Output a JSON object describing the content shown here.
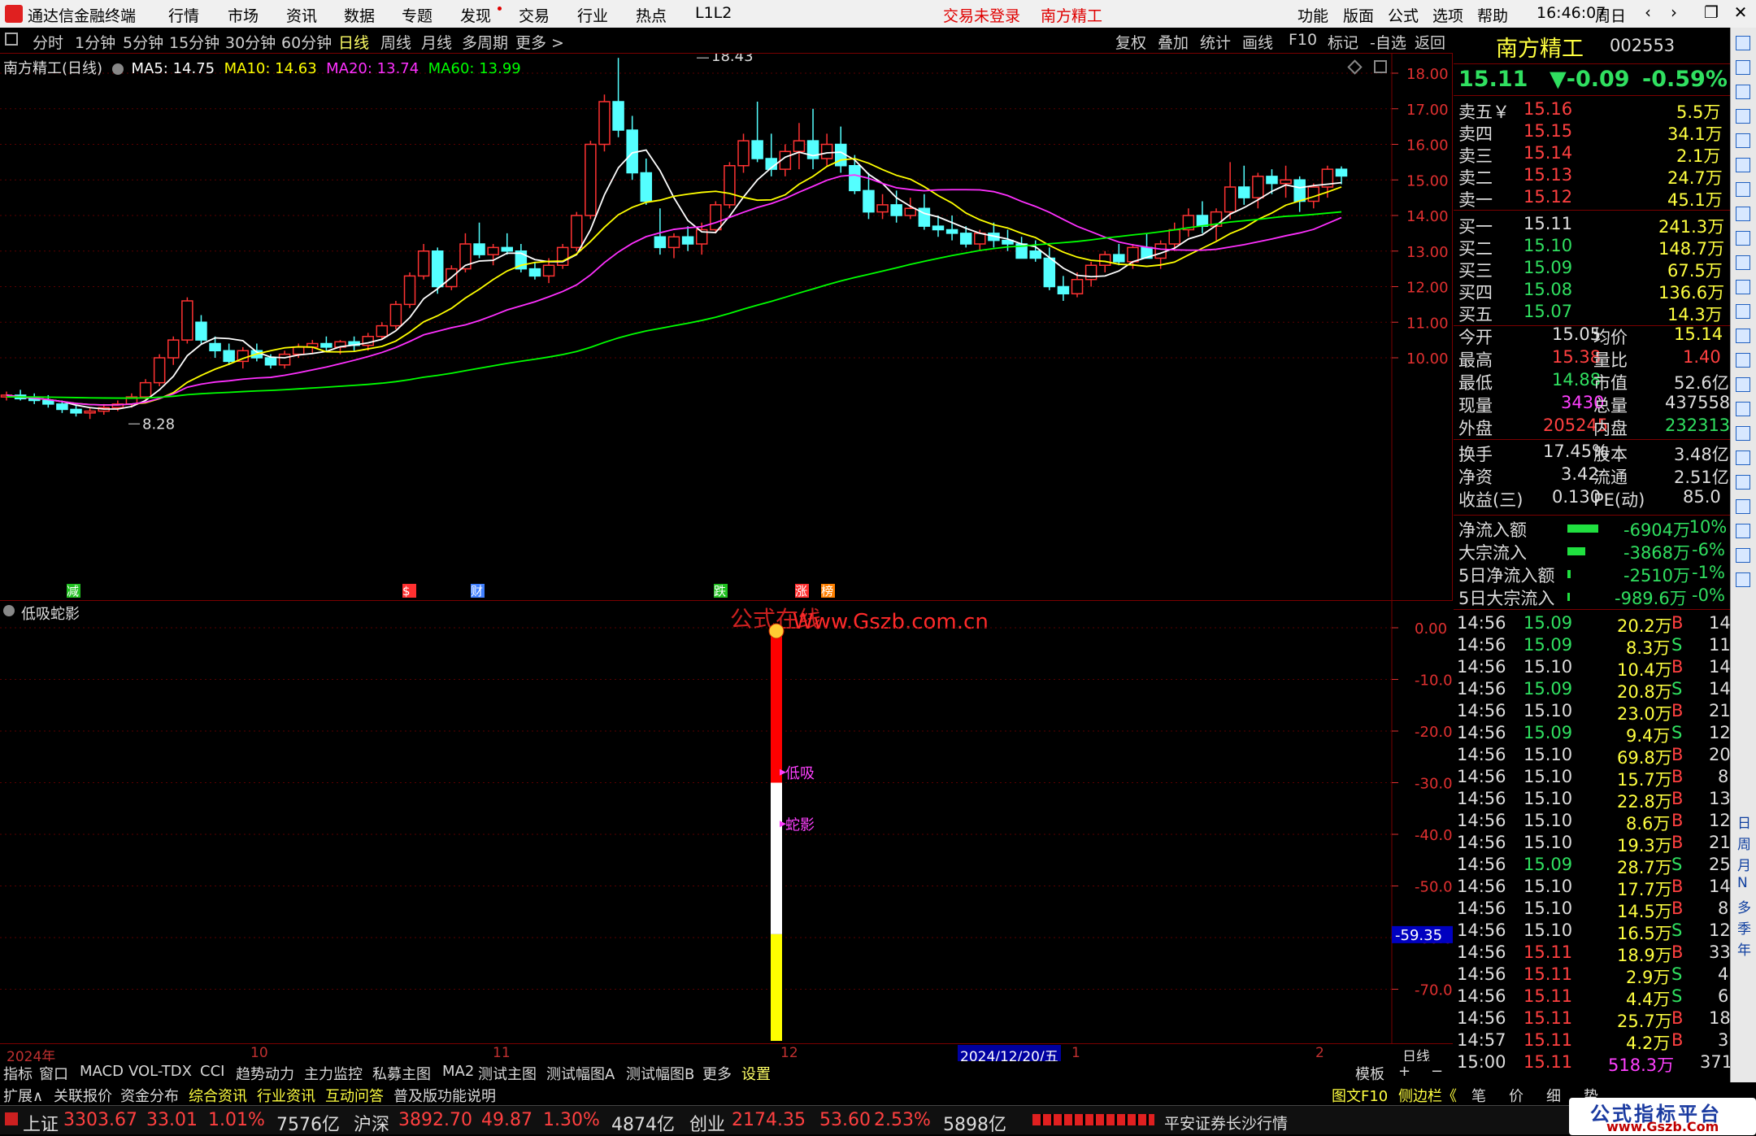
{
  "app": {
    "title": "通达信金融终端",
    "not_logged": "交易未登录",
    "stock_name": "南方精工",
    "clock": "16:46:07",
    "weekday": "周日"
  },
  "menu_left": [
    "行情",
    "市场",
    "资讯",
    "数据",
    "专题",
    "发现",
    "交易",
    "行业",
    "热点",
    "L1L2"
  ],
  "menu_right": [
    "功能",
    "版面",
    "公式",
    "选项",
    "帮助"
  ],
  "window_buttons": [
    "‹",
    "›",
    "❐",
    "–",
    "✕"
  ],
  "toolbar": {
    "periods": [
      "分时",
      "1分钟",
      "5分钟",
      "15分钟",
      "30分钟",
      "60分钟",
      "日线",
      "周线",
      "月线",
      "多周期",
      "更多 >"
    ],
    "active": "日线",
    "right": [
      "复权",
      "叠加",
      "统计",
      "画线",
      "F10",
      "标记",
      "-自选",
      "返回"
    ]
  },
  "legend": {
    "name": "南方精工(日线)",
    "ma5": "MA5: 14.75",
    "ma10": "MA10: 14.63",
    "ma20": "MA20: 13.74",
    "ma60": "MA60: 13.99",
    "c5": "#ffffff",
    "c10": "#ffff00",
    "c20": "#ff30ff",
    "c60": "#00ff00"
  },
  "main_chart": {
    "price_axis": [
      "18.00",
      "17.00",
      "16.00",
      "15.00",
      "14.00",
      "13.00",
      "12.00",
      "11.00",
      "10.00"
    ],
    "high_label": "18.43",
    "low_label": "8.28",
    "events": [
      {
        "t": "减",
        "c": "#20c020"
      },
      {
        "t": "$",
        "c": "#ff3030"
      },
      {
        "t": "财",
        "c": "#4080ff"
      },
      {
        "t": "跌",
        "c": "#20c020"
      },
      {
        "t": "涨",
        "c": "#ff3030"
      },
      {
        "t": "榜",
        "c": "#ff8000"
      }
    ]
  },
  "watermark": {
    "a": "公式在线",
    "b": "Www.Gszb.com.cn"
  },
  "chart_data": [
    {
      "type": "candlestick",
      "title": "南方精工(日线)",
      "ylim": [
        8,
        18.5
      ],
      "ohlc": [
        [
          8.9,
          9.05,
          8.8,
          8.95
        ],
        [
          8.95,
          9.1,
          8.8,
          8.85
        ],
        [
          8.85,
          9.0,
          8.7,
          8.8
        ],
        [
          8.8,
          8.95,
          8.6,
          8.7
        ],
        [
          8.7,
          8.8,
          8.45,
          8.55
        ],
        [
          8.55,
          8.65,
          8.35,
          8.45
        ],
        [
          8.45,
          8.6,
          8.28,
          8.5
        ],
        [
          8.5,
          8.7,
          8.4,
          8.6
        ],
        [
          8.6,
          8.8,
          8.5,
          8.7
        ],
        [
          8.7,
          9.0,
          8.6,
          8.9
        ],
        [
          8.9,
          9.4,
          8.8,
          9.3
        ],
        [
          9.3,
          10.1,
          9.2,
          10.0
        ],
        [
          10.0,
          10.6,
          9.8,
          10.5
        ],
        [
          10.5,
          11.7,
          10.4,
          11.6
        ],
        [
          11.0,
          11.2,
          10.4,
          10.5
        ],
        [
          10.4,
          10.6,
          10.0,
          10.2
        ],
        [
          10.2,
          10.4,
          9.8,
          9.9
        ],
        [
          9.9,
          10.3,
          9.7,
          10.2
        ],
        [
          10.2,
          10.4,
          9.9,
          10.0
        ],
        [
          10.0,
          10.1,
          9.7,
          9.8
        ],
        [
          9.8,
          10.2,
          9.7,
          10.1
        ],
        [
          10.1,
          10.4,
          10.0,
          10.3
        ],
        [
          10.3,
          10.5,
          10.1,
          10.4
        ],
        [
          10.4,
          10.6,
          10.2,
          10.3
        ],
        [
          10.3,
          10.5,
          10.1,
          10.45
        ],
        [
          10.45,
          10.6,
          10.2,
          10.35
        ],
        [
          10.35,
          10.7,
          10.2,
          10.6
        ],
        [
          10.6,
          11.0,
          10.5,
          10.9
        ],
        [
          10.9,
          11.6,
          10.8,
          11.5
        ],
        [
          11.5,
          12.4,
          11.4,
          12.3
        ],
        [
          12.3,
          13.2,
          12.2,
          13.0
        ],
        [
          13.0,
          13.1,
          11.8,
          12.0
        ],
        [
          12.0,
          12.6,
          11.9,
          12.5
        ],
        [
          12.5,
          13.5,
          12.4,
          13.2
        ],
        [
          13.2,
          13.8,
          12.8,
          12.9
        ],
        [
          12.9,
          13.2,
          12.6,
          13.1
        ],
        [
          13.1,
          13.5,
          12.9,
          13.0
        ],
        [
          13.0,
          13.2,
          12.4,
          12.5
        ],
        [
          12.5,
          12.7,
          12.2,
          12.3
        ],
        [
          12.3,
          12.8,
          12.1,
          12.6
        ],
        [
          12.6,
          13.2,
          12.5,
          13.1
        ],
        [
          13.1,
          14.1,
          13.0,
          14.0
        ],
        [
          14.0,
          16.1,
          13.9,
          16.0
        ],
        [
          16.0,
          17.4,
          15.8,
          17.2
        ],
        [
          17.2,
          18.43,
          16.2,
          16.4
        ],
        [
          16.4,
          16.8,
          15.0,
          15.2
        ],
        [
          15.2,
          15.6,
          14.3,
          14.4
        ],
        [
          13.4,
          14.2,
          12.9,
          13.1
        ],
        [
          13.1,
          13.5,
          12.8,
          13.4
        ],
        [
          13.4,
          13.7,
          13.0,
          13.2
        ],
        [
          13.2,
          13.8,
          12.9,
          13.6
        ],
        [
          13.6,
          14.4,
          13.5,
          14.3
        ],
        [
          14.3,
          15.5,
          14.2,
          15.4
        ],
        [
          15.4,
          16.3,
          15.2,
          16.1
        ],
        [
          16.1,
          17.2,
          15.5,
          15.6
        ],
        [
          15.6,
          16.3,
          15.1,
          15.3
        ],
        [
          15.3,
          16.0,
          15.1,
          15.8
        ],
        [
          15.8,
          16.6,
          15.3,
          16.1
        ],
        [
          16.1,
          17.0,
          15.3,
          15.6
        ],
        [
          15.6,
          16.3,
          15.4,
          16.0
        ],
        [
          16.0,
          16.5,
          15.2,
          15.4
        ],
        [
          15.4,
          15.7,
          14.6,
          14.7
        ],
        [
          14.7,
          15.2,
          13.9,
          14.1
        ],
        [
          14.1,
          14.6,
          13.9,
          14.3
        ],
        [
          14.3,
          14.7,
          13.8,
          14.0
        ],
        [
          14.0,
          14.5,
          13.9,
          14.2
        ],
        [
          14.2,
          14.6,
          13.6,
          13.7
        ],
        [
          13.7,
          14.0,
          13.4,
          13.6
        ],
        [
          13.6,
          14.0,
          13.3,
          13.5
        ],
        [
          13.5,
          13.7,
          13.1,
          13.2
        ],
        [
          13.2,
          13.6,
          13.0,
          13.5
        ],
        [
          13.5,
          13.8,
          13.1,
          13.3
        ],
        [
          13.3,
          13.6,
          13.0,
          13.2
        ],
        [
          13.2,
          13.4,
          12.9,
          12.8
        ],
        [
          13.0,
          13.3,
          12.7,
          12.8
        ],
        [
          12.8,
          13.1,
          11.9,
          12.0
        ],
        [
          12.0,
          12.3,
          11.6,
          11.8
        ],
        [
          11.8,
          12.4,
          11.7,
          12.2
        ],
        [
          12.2,
          12.7,
          12.0,
          12.6
        ],
        [
          12.6,
          13.0,
          12.4,
          12.9
        ],
        [
          12.9,
          13.2,
          12.6,
          12.7
        ],
        [
          12.7,
          13.2,
          12.5,
          13.1
        ],
        [
          13.1,
          13.5,
          12.9,
          12.8
        ],
        [
          12.8,
          13.3,
          12.5,
          13.2
        ],
        [
          13.2,
          13.8,
          13.0,
          13.6
        ],
        [
          13.6,
          14.2,
          13.4,
          14.0
        ],
        [
          14.0,
          14.4,
          13.5,
          13.7
        ],
        [
          13.7,
          14.2,
          13.3,
          14.1
        ],
        [
          14.1,
          15.5,
          13.9,
          14.8
        ],
        [
          14.8,
          15.4,
          14.3,
          14.5
        ],
        [
          14.5,
          15.2,
          14.2,
          15.1
        ],
        [
          15.1,
          15.3,
          14.6,
          14.9
        ],
        [
          14.9,
          15.4,
          14.5,
          15.0
        ],
        [
          15.0,
          15.1,
          14.1,
          14.4
        ],
        [
          14.4,
          14.9,
          14.2,
          14.8
        ],
        [
          14.8,
          15.4,
          14.5,
          15.3
        ],
        [
          15.3,
          15.38,
          14.88,
          15.11
        ]
      ],
      "ma": {
        "MA5": 14.75,
        "MA10": 14.63,
        "MA20": 13.74,
        "MA60": 13.99
      }
    },
    {
      "type": "bar",
      "title": "低吸蛇影",
      "ylim": [
        -80,
        2
      ],
      "values_top_to_bottom": [
        {
          "from": 0,
          "to": -30,
          "color": "#ff0000"
        },
        {
          "from": -30,
          "to": -59.35,
          "color": "#ffffff"
        },
        {
          "from": -59.35,
          "to": -80,
          "color": "#ffff00"
        }
      ],
      "labels": [
        {
          "t": "低吸",
          "v": -28
        },
        {
          "t": "蛇影",
          "v": -38
        }
      ],
      "marker_value": "-59.35",
      "axis": [
        "0.00",
        "-10.00",
        "-20.00",
        "-30.00",
        "-40.00",
        "-50.00",
        "-60.00",
        "-70.00"
      ]
    }
  ],
  "sub": {
    "title": "低吸蛇影",
    "lbl1": "低吸",
    "lbl2": "蛇影",
    "mark": "-59.35"
  },
  "dateaxis": {
    "year": "2024年",
    "m10": "10",
    "m11": "11",
    "m12": "12",
    "sel": "2024/12/20/五",
    "d1": "1",
    "d2": "2",
    "right": "日线"
  },
  "tabs1": [
    "指标",
    "窗口",
    "MACD",
    "VOL-TDX",
    "CCI",
    "趋势动力",
    "主力监控",
    "私募主图",
    "MA2",
    "测试主图",
    "测试幅图A",
    "测试幅图B",
    "更多",
    "设置"
  ],
  "tabs1_right": [
    "模板",
    "+",
    "−"
  ],
  "tabs2": [
    "扩展∧",
    "关联报价",
    "资金分布",
    "综合资讯",
    "行业资讯",
    "互动问答",
    "普及版功能说明"
  ],
  "tabs2_right": [
    "图文F10",
    "侧边栏《",
    "笔",
    "价",
    "细",
    "势"
  ],
  "status": {
    "sh_name": "上证",
    "sh_val": "3303.67",
    "sh_chg": "33.01",
    "sh_pct": "1.01%",
    "sh_amt": "7576亿",
    "hs_name": "沪深",
    "hs_val": "3892.70",
    "hs_chg": "49.87",
    "hs_pct": "1.30%",
    "hs_amt": "4874亿",
    "cy_name": "创业",
    "cy_val": "2174.35",
    "cy_chg": "53.60",
    "cy_pct": "2.53%",
    "cy_amt": "5898亿",
    "broker": "平安证券长沙行情",
    "logo": "公式指标平台",
    "logo_url": "www.Gszb.Com"
  },
  "quote": {
    "name": "南方精工",
    "code": "002553",
    "price": "15.11",
    "chg": "▼-0.09",
    "pct": "-0.59%",
    "asks": [
      {
        "l": "卖五￥",
        "p": "15.16",
        "v": "5.5万"
      },
      {
        "l": "卖四",
        "p": "15.15",
        "v": "34.1万"
      },
      {
        "l": "卖三",
        "p": "15.14",
        "v": "2.1万"
      },
      {
        "l": "卖二",
        "p": "15.13",
        "v": "24.7万"
      },
      {
        "l": "卖一",
        "p": "15.12",
        "v": "45.1万"
      }
    ],
    "bids": [
      {
        "l": "买一",
        "p": "15.11",
        "v": "241.3万"
      },
      {
        "l": "买二",
        "p": "15.10",
        "v": "148.7万"
      },
      {
        "l": "买三",
        "p": "15.09",
        "v": "67.5万"
      },
      {
        "l": "买四",
        "p": "15.08",
        "v": "136.6万"
      },
      {
        "l": "买五",
        "p": "15.07",
        "v": "14.3万"
      }
    ],
    "stats": [
      [
        "今开",
        "15.05",
        "均价",
        "15.14"
      ],
      [
        "最高",
        "15.38",
        "量比",
        "1.40"
      ],
      [
        "最低",
        "14.88",
        "市值",
        "52.6亿"
      ],
      [
        "现量",
        "3430",
        "总量",
        "437558"
      ],
      [
        "外盘",
        "205245",
        "内盘",
        "232313"
      ],
      [
        "换手",
        "17.45%",
        "股本",
        "3.48亿"
      ],
      [
        "净资",
        "3.42",
        "流通",
        "2.51亿"
      ],
      [
        "收益(三)",
        "0.130",
        "PE(动)",
        "85.0"
      ]
    ],
    "flows": [
      [
        "净流入额",
        "-6904万",
        "-10%"
      ],
      [
        "大宗流入",
        "-3868万",
        "-6%"
      ],
      [
        "5日净流入额",
        "-2510万",
        "-1%"
      ],
      [
        "5日大宗流入",
        "-989.6万",
        "-0%"
      ]
    ],
    "ticks": [
      [
        "14:56",
        "15.09",
        "20.2万",
        "B",
        "14"
      ],
      [
        "14:56",
        "15.09",
        "8.3万",
        "S",
        "11"
      ],
      [
        "14:56",
        "15.10",
        "10.4万",
        "B",
        "14"
      ],
      [
        "14:56",
        "15.09",
        "20.8万",
        "S",
        "14"
      ],
      [
        "14:56",
        "15.10",
        "23.0万",
        "B",
        "21"
      ],
      [
        "14:56",
        "15.09",
        "9.4万",
        "S",
        "12"
      ],
      [
        "14:56",
        "15.10",
        "69.8万",
        "B",
        "20"
      ],
      [
        "14:56",
        "15.10",
        "15.7万",
        "B",
        "8"
      ],
      [
        "14:56",
        "15.10",
        "22.8万",
        "B",
        "13"
      ],
      [
        "14:56",
        "15.10",
        "8.6万",
        "B",
        "12"
      ],
      [
        "14:56",
        "15.10",
        "19.3万",
        "B",
        "21"
      ],
      [
        "14:56",
        "15.09",
        "28.7万",
        "S",
        "25"
      ],
      [
        "14:56",
        "15.10",
        "17.7万",
        "B",
        "14"
      ],
      [
        "14:56",
        "15.10",
        "14.5万",
        "B",
        "8"
      ],
      [
        "14:56",
        "15.10",
        "16.5万",
        "S",
        "12"
      ],
      [
        "14:56",
        "15.11",
        "18.9万",
        "B",
        "33"
      ],
      [
        "14:56",
        "15.11",
        "2.9万",
        "S",
        "4"
      ],
      [
        "14:56",
        "15.11",
        "4.4万",
        "S",
        "6"
      ],
      [
        "14:56",
        "15.11",
        "25.7万",
        "B",
        "18"
      ],
      [
        "14:57",
        "15.11",
        "4.2万",
        "B",
        "3"
      ],
      [
        "15:00",
        "15.11",
        "518.3万",
        "",
        "371"
      ]
    ]
  },
  "sidebar": [
    "日",
    "周",
    "月",
    "N",
    "多",
    "季",
    "年"
  ]
}
